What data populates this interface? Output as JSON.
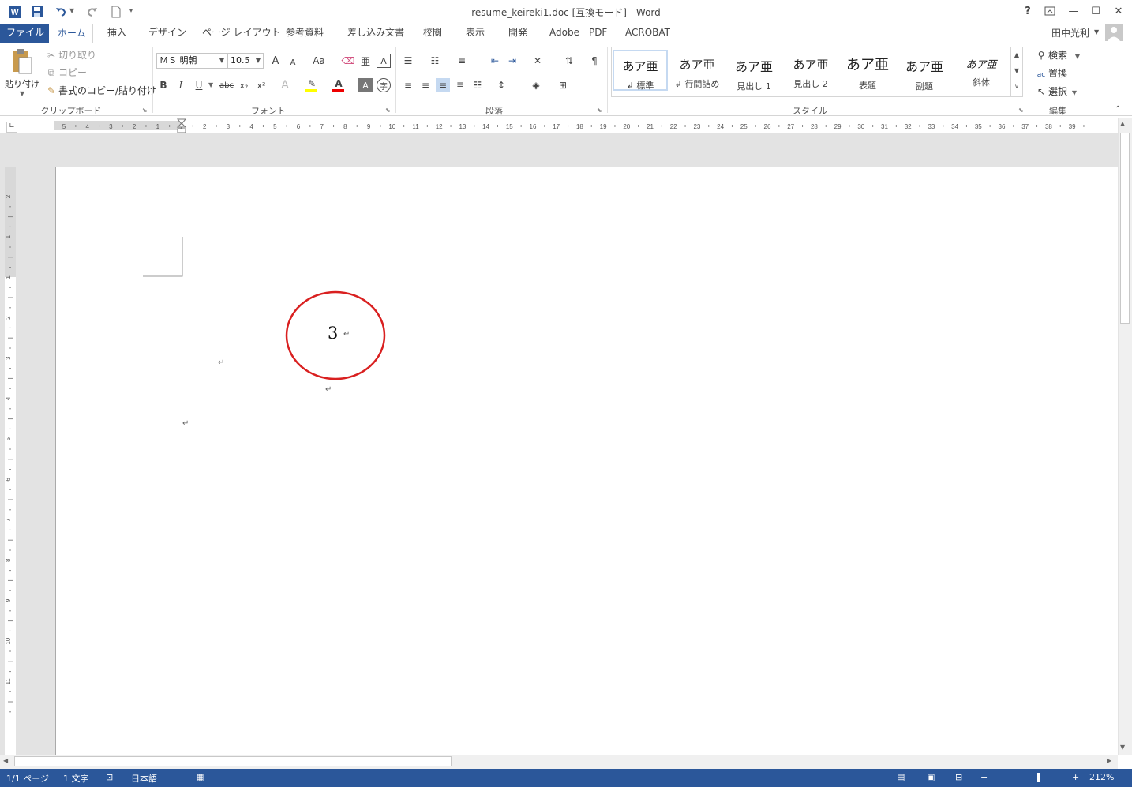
{
  "window": {
    "title": "resume_keireki1.doc [互換モード] - Word",
    "help": "?",
    "restore_ribbon": "⊼",
    "minimize": "—",
    "maximize": "☐",
    "close": "✕"
  },
  "quick_access": {
    "app_icon": "W",
    "save_icon": "save-icon",
    "undo_icon": "undo-icon",
    "redo_icon": "redo-icon"
  },
  "tabs": [
    {
      "label": "ファイル"
    },
    {
      "label": "ホーム"
    },
    {
      "label": "挿入"
    },
    {
      "label": "デザイン"
    },
    {
      "label": "ページ レイアウト"
    },
    {
      "label": "参考資料"
    },
    {
      "label": "差し込み文書"
    },
    {
      "label": "校閲"
    },
    {
      "label": "表示"
    },
    {
      "label": "開発"
    },
    {
      "label": "Adobe　PDF"
    },
    {
      "label": "ACROBAT"
    }
  ],
  "user": {
    "name": "田中光利"
  },
  "clipboard": {
    "paste": "貼り付け",
    "cut": "切り取り",
    "copy": "コピー",
    "format_painter": "書式のコピー/貼り付け",
    "group_label": "クリップボード"
  },
  "font": {
    "name": "ＭＳ 明朝",
    "size": "10.5",
    "group_label": "フォント",
    "grow": "A",
    "shrink": "A",
    "case": "Aa",
    "bold": "B",
    "italic": "I",
    "underline": "U",
    "strike": "abc",
    "subscript": "x₂",
    "superscript": "x²"
  },
  "paragraph": {
    "group_label": "段落"
  },
  "styles": {
    "group_label": "スタイル",
    "items": [
      {
        "preview": "あア亜",
        "name": "↲ 標準"
      },
      {
        "preview": "あア亜",
        "name": "↲ 行間詰め"
      },
      {
        "preview": "あア亜",
        "name": "見出し 1"
      },
      {
        "preview": "あア亜",
        "name": "見出し 2"
      },
      {
        "preview": "あア亜",
        "name": "表題"
      },
      {
        "preview": "あア亜",
        "name": "副題"
      },
      {
        "preview": "あア亜",
        "name": "斜体"
      }
    ]
  },
  "editing": {
    "group_label": "編集",
    "find": "検索",
    "replace": "置換",
    "select": "選択"
  },
  "ruler": {
    "h_numbers": [
      "5",
      "4",
      "3",
      "2",
      "1",
      "1",
      "2",
      "3",
      "4",
      "5",
      "6",
      "7",
      "8",
      "9",
      "10",
      "11",
      "12",
      "13",
      "14",
      "15",
      "16",
      "17",
      "18",
      "19",
      "20",
      "21",
      "22",
      "23",
      "24",
      "25",
      "26",
      "27",
      "28",
      "29",
      "30",
      "31",
      "32",
      "33",
      "34",
      "35",
      "36",
      "37",
      "38",
      "39"
    ],
    "v_numbers": [
      "2",
      "1",
      "1",
      "2",
      "3",
      "4",
      "5",
      "6",
      "7",
      "8",
      "9",
      "10",
      "11"
    ]
  },
  "document": {
    "circled_number": "3",
    "para_mark": "↵"
  },
  "status": {
    "page": "1/1 ページ",
    "words": "1 文字",
    "language": "日本語",
    "zoom": "212%"
  },
  "colors": {
    "accent": "#2b579a",
    "circle": "#d92020"
  }
}
